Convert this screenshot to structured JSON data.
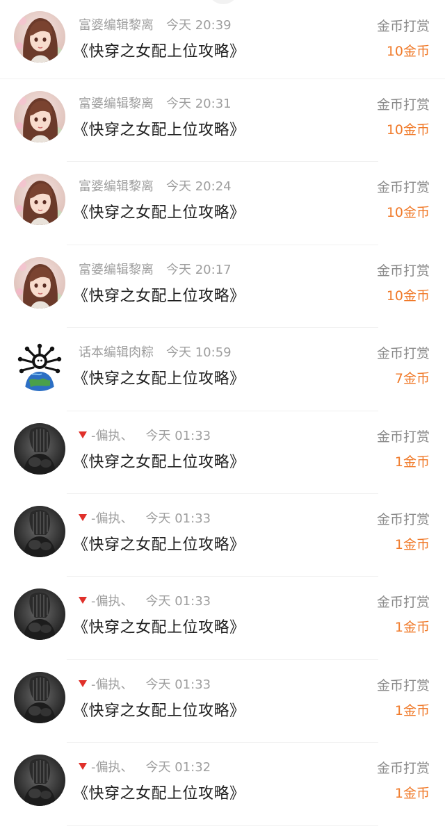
{
  "items": [
    {
      "user": "富婆编辑黎离",
      "prefix": "",
      "time": "今天 20:39",
      "book": "《快穿之女配上位攻略》",
      "label": "金币打赏",
      "amount": "10金币",
      "avatar": "anime-girl-avatar"
    },
    {
      "user": "富婆编辑黎离",
      "prefix": "",
      "time": "今天 20:31",
      "book": "《快穿之女配上位攻略》",
      "label": "金币打赏",
      "amount": "10金币",
      "avatar": "anime-girl-avatar"
    },
    {
      "user": "富婆编辑黎离",
      "prefix": "",
      "time": "今天 20:24",
      "book": "《快穿之女配上位攻略》",
      "label": "金币打赏",
      "amount": "10金币",
      "avatar": "anime-girl-avatar"
    },
    {
      "user": "富婆编辑黎离",
      "prefix": "",
      "time": "今天 20:17",
      "book": "《快穿之女配上位攻略》",
      "label": "金币打赏",
      "amount": "10金币",
      "avatar": "anime-girl-avatar"
    },
    {
      "user": "话本编辑肉粽",
      "prefix": "",
      "time": "今天 10:59",
      "book": "《快穿之女配上位攻略》",
      "label": "金币打赏",
      "amount": "7金币",
      "avatar": "globe-creature-avatar"
    },
    {
      "user": "-偏执、",
      "prefix": "triangle",
      "time": "今天 01:33",
      "book": "《快穿之女配上位攻略》",
      "label": "金币打赏",
      "amount": "1金币",
      "avatar": "dark-figure-avatar"
    },
    {
      "user": "-偏执、",
      "prefix": "triangle",
      "time": "今天 01:33",
      "book": "《快穿之女配上位攻略》",
      "label": "金币打赏",
      "amount": "1金币",
      "avatar": "dark-figure-avatar"
    },
    {
      "user": "-偏执、",
      "prefix": "triangle",
      "time": "今天 01:33",
      "book": "《快穿之女配上位攻略》",
      "label": "金币打赏",
      "amount": "1金币",
      "avatar": "dark-figure-avatar"
    },
    {
      "user": "-偏执、",
      "prefix": "triangle",
      "time": "今天 01:33",
      "book": "《快穿之女配上位攻略》",
      "label": "金币打赏",
      "amount": "1金币",
      "avatar": "dark-figure-avatar"
    },
    {
      "user": "-偏执、",
      "prefix": "triangle",
      "time": "今天 01:32",
      "book": "《快穿之女配上位攻略》",
      "label": "金币打赏",
      "amount": "1金币",
      "avatar": "dark-figure-avatar"
    }
  ],
  "colors": {
    "amount": "#f07a2a",
    "meta": "#9e9e9e",
    "title": "#1f1f1f",
    "label": "#8a8a8a",
    "triangle": "#e0302a"
  }
}
